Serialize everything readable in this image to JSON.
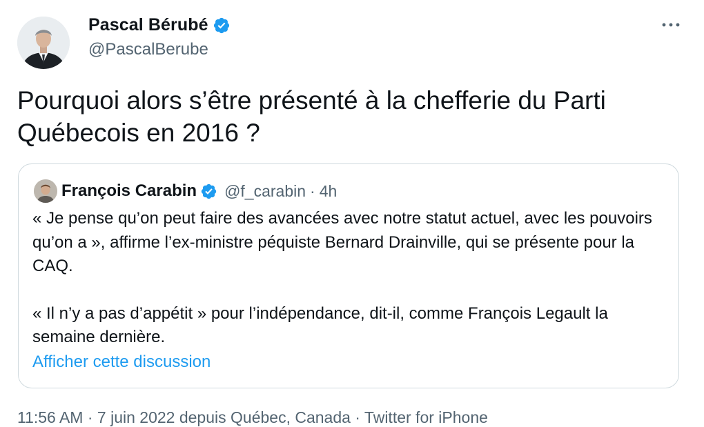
{
  "tweet": {
    "author": {
      "display_name": "Pascal Bérubé",
      "handle": "@PascalBerube",
      "verified_icon": "verified-badge-icon"
    },
    "more_icon": "more-horizontal-icon",
    "text": "Pourquoi alors s’être présenté à la chefferie du Parti Québecois en 2016 ?",
    "quote": {
      "author": {
        "display_name": "François Carabin",
        "handle": "@f_carabin",
        "time": "4h",
        "separator": "·"
      },
      "paragraphs": [
        "« Je pense qu’on peut faire des avancées avec notre statut actuel, avec les pouvoirs qu’on a », affirme l’ex-ministre péquiste Bernard Drainville, qui se présente pour la CAQ.",
        "« Il n’y a pas d’appétit » pour l’indépendance, dit-il, comme François Legault la semaine dernière."
      ],
      "show_thread": "Afficher cette discussion"
    },
    "meta": "11:56 AM · 7 juin 2022 depuis Québec, Canada · Twitter for iPhone"
  },
  "colors": {
    "text": "#0f1419",
    "secondary": "#536471",
    "accent": "#1d9bf0",
    "border": "#cfd9de"
  }
}
